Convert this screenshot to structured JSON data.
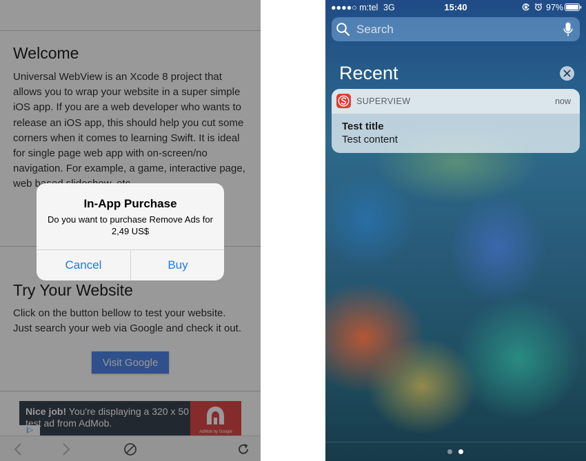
{
  "left_screen": {
    "welcome": {
      "title": "Welcome",
      "text": "Universal WebView is an Xcode 8 project that allows you to wrap your website in a super simple iOS app. If you are a web developer who wants to release an iOS app, this should help you cut some corners when it comes to learning Swift. It is ideal for single page web app with on-screen/no navigation. For example, a game, interactive page, web based slideshow, etc."
    },
    "try_website": {
      "title": "Try Your Website",
      "text": "Click on the button bellow to test your website. Just search your web via Google and check it out.",
      "button_label": "Visit Google",
      "button_color": "#4f86e9"
    },
    "ad": {
      "bold": "Nice job!",
      "text": " You're displaying a 320 x 50 test ad from AdMob.",
      "logo_caption": "AdMob by Google",
      "badge": "|▷",
      "brand_color": "#e04848"
    },
    "toolbar": {
      "icons": [
        "back-icon",
        "forward-icon",
        "stop-icon",
        "reload-icon"
      ]
    },
    "alert": {
      "title": "In-App Purchase",
      "message": "Do you want to purchase Remove Ads for 2,49 US$",
      "cancel_label": "Cancel",
      "buy_label": "Buy",
      "button_color": "#1a7cf5"
    }
  },
  "right_screen": {
    "status_bar": {
      "carrier": "●●●●○ m:tel",
      "network": "3G",
      "time": "15:40",
      "battery": "97%"
    },
    "search": {
      "placeholder": "Search"
    },
    "recent_title": "Recent",
    "notification": {
      "app_name": "SUPERVIEW",
      "time": "now",
      "title": "Test title",
      "body": "Test content",
      "app_color": "#e53935"
    },
    "page_dots": {
      "count": 2,
      "active": 2
    }
  }
}
